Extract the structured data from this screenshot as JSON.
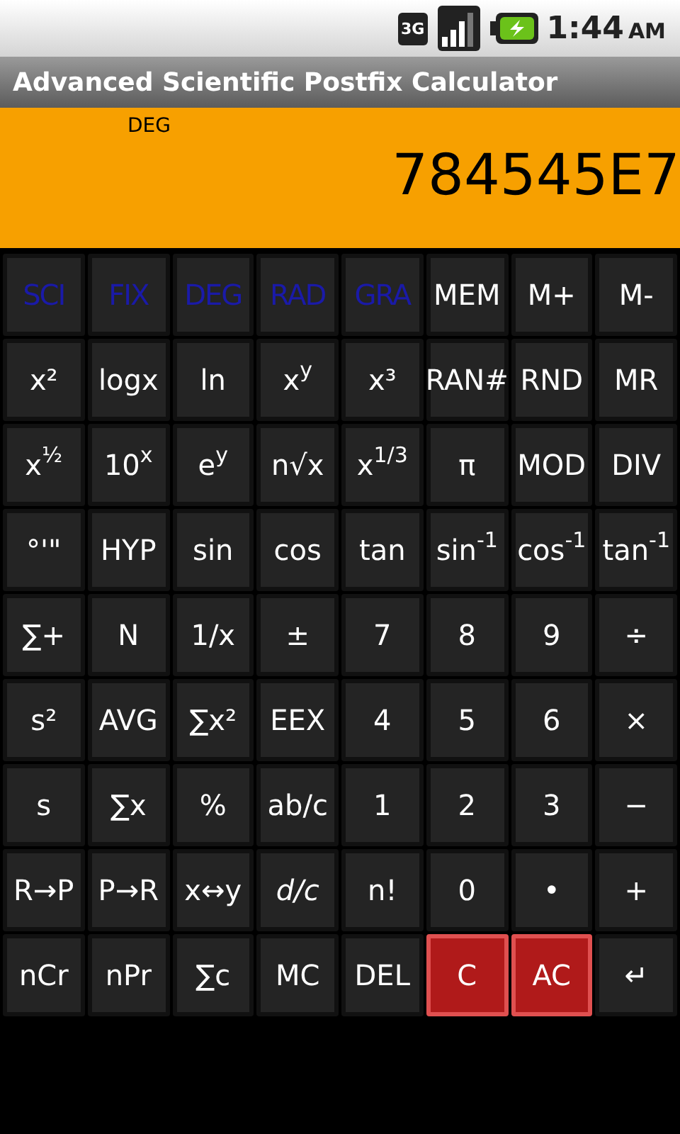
{
  "status_bar": {
    "network": "3G",
    "time": "1:44",
    "ampm": "AM"
  },
  "title_bar": {
    "title": "Advanced Scientific Postfix Calculator"
  },
  "display": {
    "mode": "DEG",
    "value": "784545E7"
  },
  "keypad": {
    "rows": [
      [
        {
          "label": "SCI",
          "kind": "mode"
        },
        {
          "label": "FIX",
          "kind": "mode"
        },
        {
          "label": "DEG",
          "kind": "mode"
        },
        {
          "label": "RAD",
          "kind": "mode"
        },
        {
          "label": "GRA",
          "kind": "mode"
        },
        {
          "label": "MEM",
          "kind": "normal"
        },
        {
          "label": "M+",
          "kind": "normal"
        },
        {
          "label": "M-",
          "kind": "normal"
        }
      ],
      [
        {
          "label": "x²",
          "kind": "normal"
        },
        {
          "label": "logx",
          "kind": "normal"
        },
        {
          "label": "ln",
          "kind": "normal"
        },
        {
          "label": "x$^{y}$",
          "kind": "normal"
        },
        {
          "label": "x³",
          "kind": "normal"
        },
        {
          "label": "RAN#",
          "kind": "normal"
        },
        {
          "label": "RND",
          "kind": "normal"
        },
        {
          "label": "MR",
          "kind": "normal"
        }
      ],
      [
        {
          "label": "x$^{½}$",
          "kind": "normal"
        },
        {
          "label": "10$^{x}$",
          "kind": "normal"
        },
        {
          "label": "e$^{y}$",
          "kind": "normal"
        },
        {
          "label": "n√x",
          "kind": "normal"
        },
        {
          "label": "x$^{1/3}$",
          "kind": "normal"
        },
        {
          "label": "π",
          "kind": "normal"
        },
        {
          "label": "MOD",
          "kind": "normal"
        },
        {
          "label": "DIV",
          "kind": "normal"
        }
      ],
      [
        {
          "label": "°'\"",
          "kind": "normal"
        },
        {
          "label": "HYP",
          "kind": "normal"
        },
        {
          "label": "sin",
          "kind": "normal"
        },
        {
          "label": "cos",
          "kind": "normal"
        },
        {
          "label": "tan",
          "kind": "normal"
        },
        {
          "label": "sin$^{-1}$",
          "kind": "normal"
        },
        {
          "label": "cos$^{-1}$",
          "kind": "normal"
        },
        {
          "label": "tan$^{-1}$",
          "kind": "normal"
        }
      ],
      [
        {
          "label": "∑+",
          "kind": "normal"
        },
        {
          "label": "N",
          "kind": "normal"
        },
        {
          "label": "1/x",
          "kind": "normal"
        },
        {
          "label": "±",
          "kind": "normal"
        },
        {
          "label": "7",
          "kind": "normal"
        },
        {
          "label": "8",
          "kind": "normal"
        },
        {
          "label": "9",
          "kind": "normal"
        },
        {
          "label": "÷",
          "kind": "normal"
        }
      ],
      [
        {
          "label": "s²",
          "kind": "normal"
        },
        {
          "label": "AVG",
          "kind": "normal"
        },
        {
          "label": "∑x²",
          "kind": "normal"
        },
        {
          "label": "EEX",
          "kind": "normal"
        },
        {
          "label": "4",
          "kind": "normal"
        },
        {
          "label": "5",
          "kind": "normal"
        },
        {
          "label": "6",
          "kind": "normal"
        },
        {
          "label": "×",
          "kind": "normal"
        }
      ],
      [
        {
          "label": "s",
          "kind": "normal"
        },
        {
          "label": "∑x",
          "kind": "normal"
        },
        {
          "label": "%",
          "kind": "normal"
        },
        {
          "label": "ab/c",
          "kind": "normal"
        },
        {
          "label": "1",
          "kind": "normal"
        },
        {
          "label": "2",
          "kind": "normal"
        },
        {
          "label": "3",
          "kind": "normal"
        },
        {
          "label": "−",
          "kind": "normal"
        }
      ],
      [
        {
          "label": "R→P",
          "kind": "normal"
        },
        {
          "label": "P→R",
          "kind": "normal"
        },
        {
          "label": "x↔y",
          "kind": "normal"
        },
        {
          "label": "*d/c*",
          "kind": "normal"
        },
        {
          "label": "n!",
          "kind": "normal"
        },
        {
          "label": "0",
          "kind": "normal"
        },
        {
          "label": "•",
          "kind": "normal"
        },
        {
          "label": "+",
          "kind": "normal"
        }
      ],
      [
        {
          "label": "nCr",
          "kind": "normal"
        },
        {
          "label": "nPr",
          "kind": "normal"
        },
        {
          "label": "∑c",
          "kind": "normal"
        },
        {
          "label": "MC",
          "kind": "normal"
        },
        {
          "label": "DEL",
          "kind": "normal"
        },
        {
          "label": "C",
          "kind": "clear"
        },
        {
          "label": "AC",
          "kind": "clear"
        },
        {
          "label": "↵",
          "kind": "normal"
        }
      ]
    ]
  }
}
